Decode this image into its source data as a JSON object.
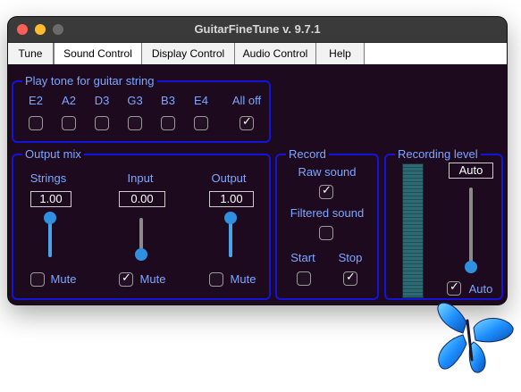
{
  "window": {
    "title": "GuitarFineTune v. 9.7.1"
  },
  "tabs": [
    {
      "label": "Tune",
      "active": false
    },
    {
      "label": "Sound Control",
      "active": true
    },
    {
      "label": "Display Control",
      "active": false
    },
    {
      "label": "Audio Control",
      "active": false
    },
    {
      "label": "Help",
      "active": false
    }
  ],
  "play_tone": {
    "legend": "Play tone for guitar string",
    "strings": [
      {
        "label": "E2",
        "checked": false
      },
      {
        "label": "A2",
        "checked": false
      },
      {
        "label": "D3",
        "checked": false
      },
      {
        "label": "G3",
        "checked": false
      },
      {
        "label": "B3",
        "checked": false
      },
      {
        "label": "E4",
        "checked": false
      },
      {
        "label": "All off",
        "checked": true
      }
    ]
  },
  "output_mix": {
    "legend": "Output mix",
    "channels": [
      {
        "label": "Strings",
        "value": "1.00",
        "level": 1.0,
        "mute_label": "Mute",
        "muted": false
      },
      {
        "label": "Input",
        "value": "0.00",
        "level": 0.0,
        "mute_label": "Mute",
        "muted": true
      },
      {
        "label": "Output",
        "value": "1.00",
        "level": 1.0,
        "mute_label": "Mute",
        "muted": false
      }
    ]
  },
  "record": {
    "legend": "Record",
    "raw_label": "Raw sound",
    "raw_checked": true,
    "filtered_label": "Filtered sound",
    "filtered_checked": false,
    "start_label": "Start",
    "start_checked": false,
    "stop_label": "Stop",
    "stop_checked": true
  },
  "recording_level": {
    "legend": "Recording level",
    "value": "Auto",
    "level": 0.0,
    "auto_label": "Auto",
    "auto_checked": true
  },
  "colors": {
    "accent": "#1414d8",
    "label": "#7da7ff",
    "slider": "#2f8fe0",
    "background": "#1e0a1f"
  }
}
